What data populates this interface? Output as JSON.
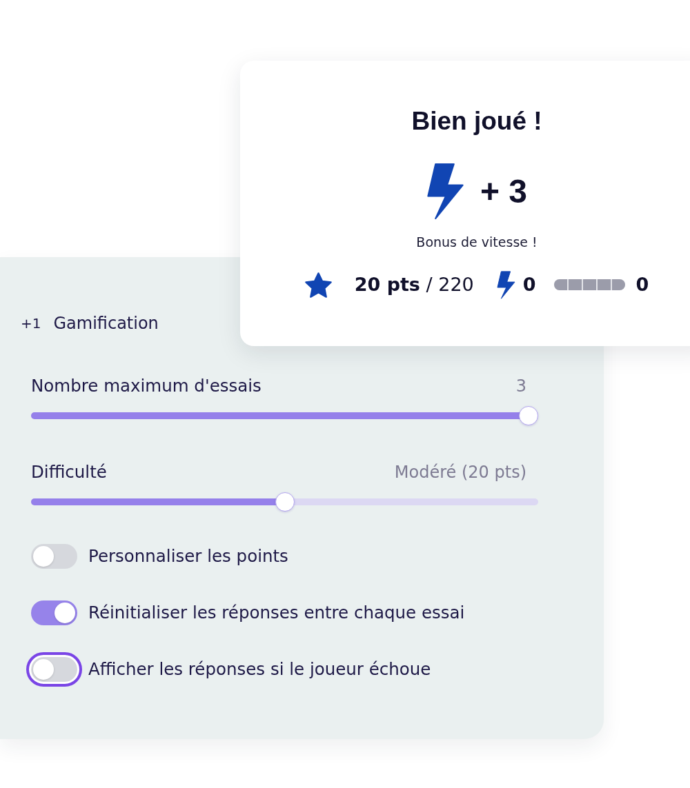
{
  "result_card": {
    "title": "Bien joué !",
    "bonus": {
      "value": "+ 3",
      "caption": "Bonus de vitesse !"
    },
    "stats": {
      "score": "**20 pts** / 220",
      "speed_bonus_count": "0",
      "progress": {
        "level": 0,
        "count": "0"
      }
    }
  },
  "settings": {
    "badge": "+1",
    "title": "Gamification",
    "sliders": [
      {
        "label": "Nombre maximum d'essais",
        "value": "3",
        "level": 1
      },
      {
        "label": "Difficulté",
        "value": "Modéré (20 pts)",
        "level": 0.5
      }
    ],
    "toggles": [
      {
        "label": "Personnaliser les points",
        "on": false,
        "focused": false
      },
      {
        "label": "Réinitialiser les réponses entre chaque essai",
        "on": true,
        "focused": false
      },
      {
        "label": "Afficher les réponses si le joueur échoue",
        "on": false,
        "focused": true
      }
    ]
  }
}
